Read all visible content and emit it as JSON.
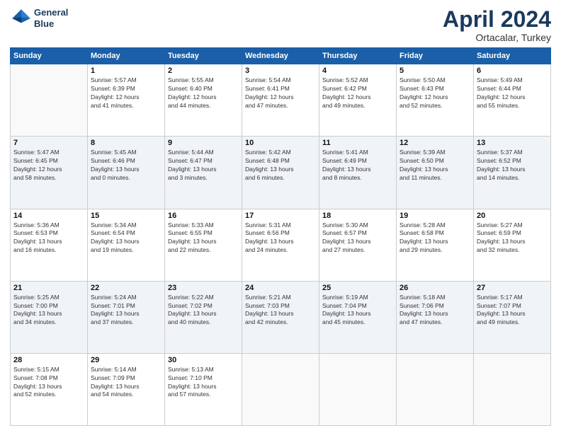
{
  "header": {
    "logo_line1": "General",
    "logo_line2": "Blue",
    "month": "April 2024",
    "location": "Ortacalar, Turkey"
  },
  "days_of_week": [
    "Sunday",
    "Monday",
    "Tuesday",
    "Wednesday",
    "Thursday",
    "Friday",
    "Saturday"
  ],
  "weeks": [
    [
      {
        "day": "",
        "detail": ""
      },
      {
        "day": "1",
        "detail": "Sunrise: 5:57 AM\nSunset: 6:39 PM\nDaylight: 12 hours\nand 41 minutes."
      },
      {
        "day": "2",
        "detail": "Sunrise: 5:55 AM\nSunset: 6:40 PM\nDaylight: 12 hours\nand 44 minutes."
      },
      {
        "day": "3",
        "detail": "Sunrise: 5:54 AM\nSunset: 6:41 PM\nDaylight: 12 hours\nand 47 minutes."
      },
      {
        "day": "4",
        "detail": "Sunrise: 5:52 AM\nSunset: 6:42 PM\nDaylight: 12 hours\nand 49 minutes."
      },
      {
        "day": "5",
        "detail": "Sunrise: 5:50 AM\nSunset: 6:43 PM\nDaylight: 12 hours\nand 52 minutes."
      },
      {
        "day": "6",
        "detail": "Sunrise: 5:49 AM\nSunset: 6:44 PM\nDaylight: 12 hours\nand 55 minutes."
      }
    ],
    [
      {
        "day": "7",
        "detail": "Sunrise: 5:47 AM\nSunset: 6:45 PM\nDaylight: 12 hours\nand 58 minutes."
      },
      {
        "day": "8",
        "detail": "Sunrise: 5:45 AM\nSunset: 6:46 PM\nDaylight: 13 hours\nand 0 minutes."
      },
      {
        "day": "9",
        "detail": "Sunrise: 5:44 AM\nSunset: 6:47 PM\nDaylight: 13 hours\nand 3 minutes."
      },
      {
        "day": "10",
        "detail": "Sunrise: 5:42 AM\nSunset: 6:48 PM\nDaylight: 13 hours\nand 6 minutes."
      },
      {
        "day": "11",
        "detail": "Sunrise: 5:41 AM\nSunset: 6:49 PM\nDaylight: 13 hours\nand 8 minutes."
      },
      {
        "day": "12",
        "detail": "Sunrise: 5:39 AM\nSunset: 6:50 PM\nDaylight: 13 hours\nand 11 minutes."
      },
      {
        "day": "13",
        "detail": "Sunrise: 5:37 AM\nSunset: 6:52 PM\nDaylight: 13 hours\nand 14 minutes."
      }
    ],
    [
      {
        "day": "14",
        "detail": "Sunrise: 5:36 AM\nSunset: 6:53 PM\nDaylight: 13 hours\nand 16 minutes."
      },
      {
        "day": "15",
        "detail": "Sunrise: 5:34 AM\nSunset: 6:54 PM\nDaylight: 13 hours\nand 19 minutes."
      },
      {
        "day": "16",
        "detail": "Sunrise: 5:33 AM\nSunset: 6:55 PM\nDaylight: 13 hours\nand 22 minutes."
      },
      {
        "day": "17",
        "detail": "Sunrise: 5:31 AM\nSunset: 6:56 PM\nDaylight: 13 hours\nand 24 minutes."
      },
      {
        "day": "18",
        "detail": "Sunrise: 5:30 AM\nSunset: 6:57 PM\nDaylight: 13 hours\nand 27 minutes."
      },
      {
        "day": "19",
        "detail": "Sunrise: 5:28 AM\nSunset: 6:58 PM\nDaylight: 13 hours\nand 29 minutes."
      },
      {
        "day": "20",
        "detail": "Sunrise: 5:27 AM\nSunset: 6:59 PM\nDaylight: 13 hours\nand 32 minutes."
      }
    ],
    [
      {
        "day": "21",
        "detail": "Sunrise: 5:25 AM\nSunset: 7:00 PM\nDaylight: 13 hours\nand 34 minutes."
      },
      {
        "day": "22",
        "detail": "Sunrise: 5:24 AM\nSunset: 7:01 PM\nDaylight: 13 hours\nand 37 minutes."
      },
      {
        "day": "23",
        "detail": "Sunrise: 5:22 AM\nSunset: 7:02 PM\nDaylight: 13 hours\nand 40 minutes."
      },
      {
        "day": "24",
        "detail": "Sunrise: 5:21 AM\nSunset: 7:03 PM\nDaylight: 13 hours\nand 42 minutes."
      },
      {
        "day": "25",
        "detail": "Sunrise: 5:19 AM\nSunset: 7:04 PM\nDaylight: 13 hours\nand 45 minutes."
      },
      {
        "day": "26",
        "detail": "Sunrise: 5:18 AM\nSunset: 7:06 PM\nDaylight: 13 hours\nand 47 minutes."
      },
      {
        "day": "27",
        "detail": "Sunrise: 5:17 AM\nSunset: 7:07 PM\nDaylight: 13 hours\nand 49 minutes."
      }
    ],
    [
      {
        "day": "28",
        "detail": "Sunrise: 5:15 AM\nSunset: 7:08 PM\nDaylight: 13 hours\nand 52 minutes."
      },
      {
        "day": "29",
        "detail": "Sunrise: 5:14 AM\nSunset: 7:09 PM\nDaylight: 13 hours\nand 54 minutes."
      },
      {
        "day": "30",
        "detail": "Sunrise: 5:13 AM\nSunset: 7:10 PM\nDaylight: 13 hours\nand 57 minutes."
      },
      {
        "day": "",
        "detail": ""
      },
      {
        "day": "",
        "detail": ""
      },
      {
        "day": "",
        "detail": ""
      },
      {
        "day": "",
        "detail": ""
      }
    ]
  ]
}
